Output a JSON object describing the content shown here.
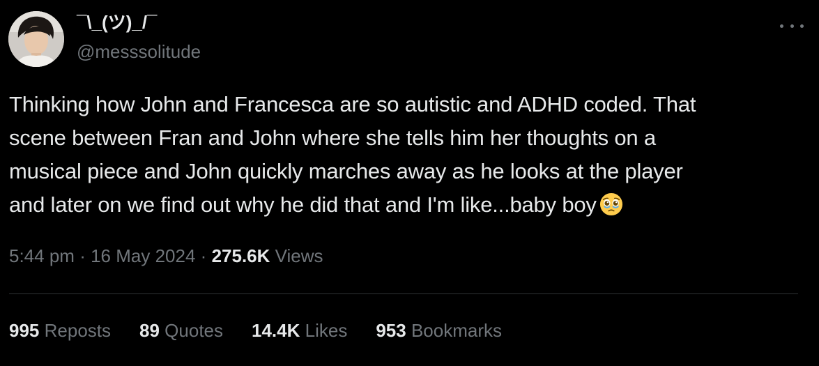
{
  "author": {
    "display_name": "¯\\_(ツ)_/¯",
    "handle": "@messsolitude",
    "avatar_icon": "user-photo-avatar"
  },
  "tweet": {
    "lines": [
      "Thinking how John and Francesca are so autistic and ADHD coded. That",
      "scene between Fran and John where she tells him her thoughts on a",
      "musical piece and John quickly marches away as he looks at the player",
      "and later on we find out why he did that and I'm like...baby boy"
    ],
    "emoji": "pleading-face-teary-emoji"
  },
  "meta": {
    "time": "5:44 pm",
    "sep1": "·",
    "date": "16 May 2024",
    "sep2": "·",
    "views_count": "275.6K",
    "views_label": "Views"
  },
  "stats": {
    "reposts": {
      "count": "995",
      "label": "Reposts"
    },
    "quotes": {
      "count": "89",
      "label": "Quotes"
    },
    "likes": {
      "count": "14.4K",
      "label": "Likes"
    },
    "bookmarks": {
      "count": "953",
      "label": "Bookmarks"
    }
  },
  "colors": {
    "background": "#000000",
    "primary_text": "#e7e9ea",
    "secondary_text": "#71767b",
    "divider": "#2f3336"
  }
}
